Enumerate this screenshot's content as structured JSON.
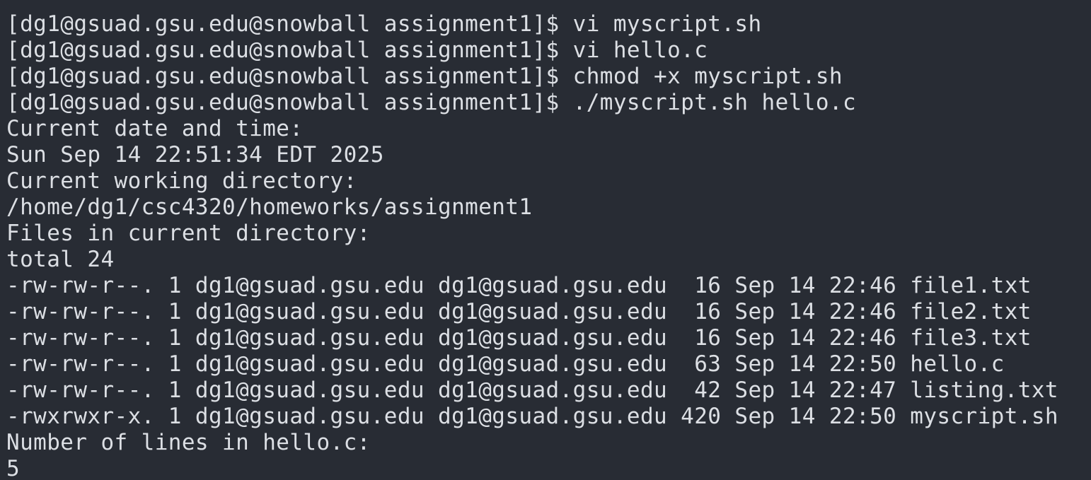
{
  "terminal": {
    "lines": [
      "[dg1@gsuad.gsu.edu@snowball assignment1]$ vi myscript.sh",
      "[dg1@gsuad.gsu.edu@snowball assignment1]$ vi hello.c",
      "[dg1@gsuad.gsu.edu@snowball assignment1]$ chmod +x myscript.sh",
      "[dg1@gsuad.gsu.edu@snowball assignment1]$ ./myscript.sh hello.c",
      "Current date and time:",
      "Sun Sep 14 22:51:34 EDT 2025",
      "Current working directory:",
      "/home/dg1/csc4320/homeworks/assignment1",
      "Files in current directory:",
      "total 24",
      "-rw-rw-r--. 1 dg1@gsuad.gsu.edu dg1@gsuad.gsu.edu  16 Sep 14 22:46 file1.txt",
      "-rw-rw-r--. 1 dg1@gsuad.gsu.edu dg1@gsuad.gsu.edu  16 Sep 14 22:46 file2.txt",
      "-rw-rw-r--. 1 dg1@gsuad.gsu.edu dg1@gsuad.gsu.edu  16 Sep 14 22:46 file3.txt",
      "-rw-rw-r--. 1 dg1@gsuad.gsu.edu dg1@gsuad.gsu.edu  63 Sep 14 22:50 hello.c",
      "-rw-rw-r--. 1 dg1@gsuad.gsu.edu dg1@gsuad.gsu.edu  42 Sep 14 22:47 listing.txt",
      "-rwxrwxr-x. 1 dg1@gsuad.gsu.edu dg1@gsuad.gsu.edu 420 Sep 14 22:50 myscript.sh",
      "Number of lines in hello.c:",
      "5"
    ]
  },
  "colors": {
    "background": "#282c34",
    "foreground": "#dcdfe4"
  }
}
